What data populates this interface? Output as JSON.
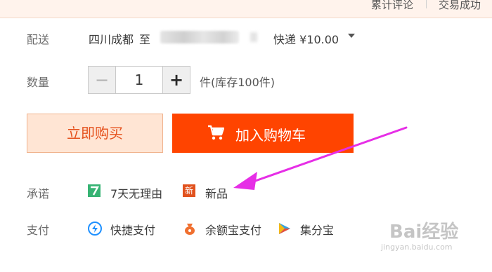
{
  "header": {
    "reviews_tab": "累计评论",
    "deals_tab": "交易成功"
  },
  "delivery": {
    "label": "配送",
    "from": "四川成都",
    "to": "至",
    "method": "快递",
    "price": "¥10.00"
  },
  "quantity": {
    "label": "数量",
    "minus": "−",
    "value": "1",
    "plus": "+",
    "stock": "件(库存100件)"
  },
  "actions": {
    "buy_now": "立即购买",
    "add_to_cart": "加入购物车"
  },
  "promise": {
    "label": "承诺",
    "items": [
      {
        "icon": "seven-day-return-icon",
        "icon_text": "7",
        "text": "7天无理由",
        "color": "#36b373"
      },
      {
        "icon": "new-product-icon",
        "icon_text": "新",
        "text": "新品",
        "color": "#e1521e"
      }
    ]
  },
  "payment": {
    "label": "支付",
    "items": [
      {
        "icon": "quick-pay-icon",
        "text": "快捷支付",
        "color": "#1e90ff"
      },
      {
        "icon": "yuebao-icon",
        "text": "余额宝支付",
        "color": "#f07030"
      },
      {
        "icon": "jifenbao-icon",
        "text": "集分宝",
        "color": "#36a3e0"
      }
    ]
  },
  "colors": {
    "accent": "#ff4400",
    "annotation_arrow": "#e62ee6"
  },
  "watermark": {
    "text": "Bai经验",
    "url": "jingyan.baidu.com"
  }
}
